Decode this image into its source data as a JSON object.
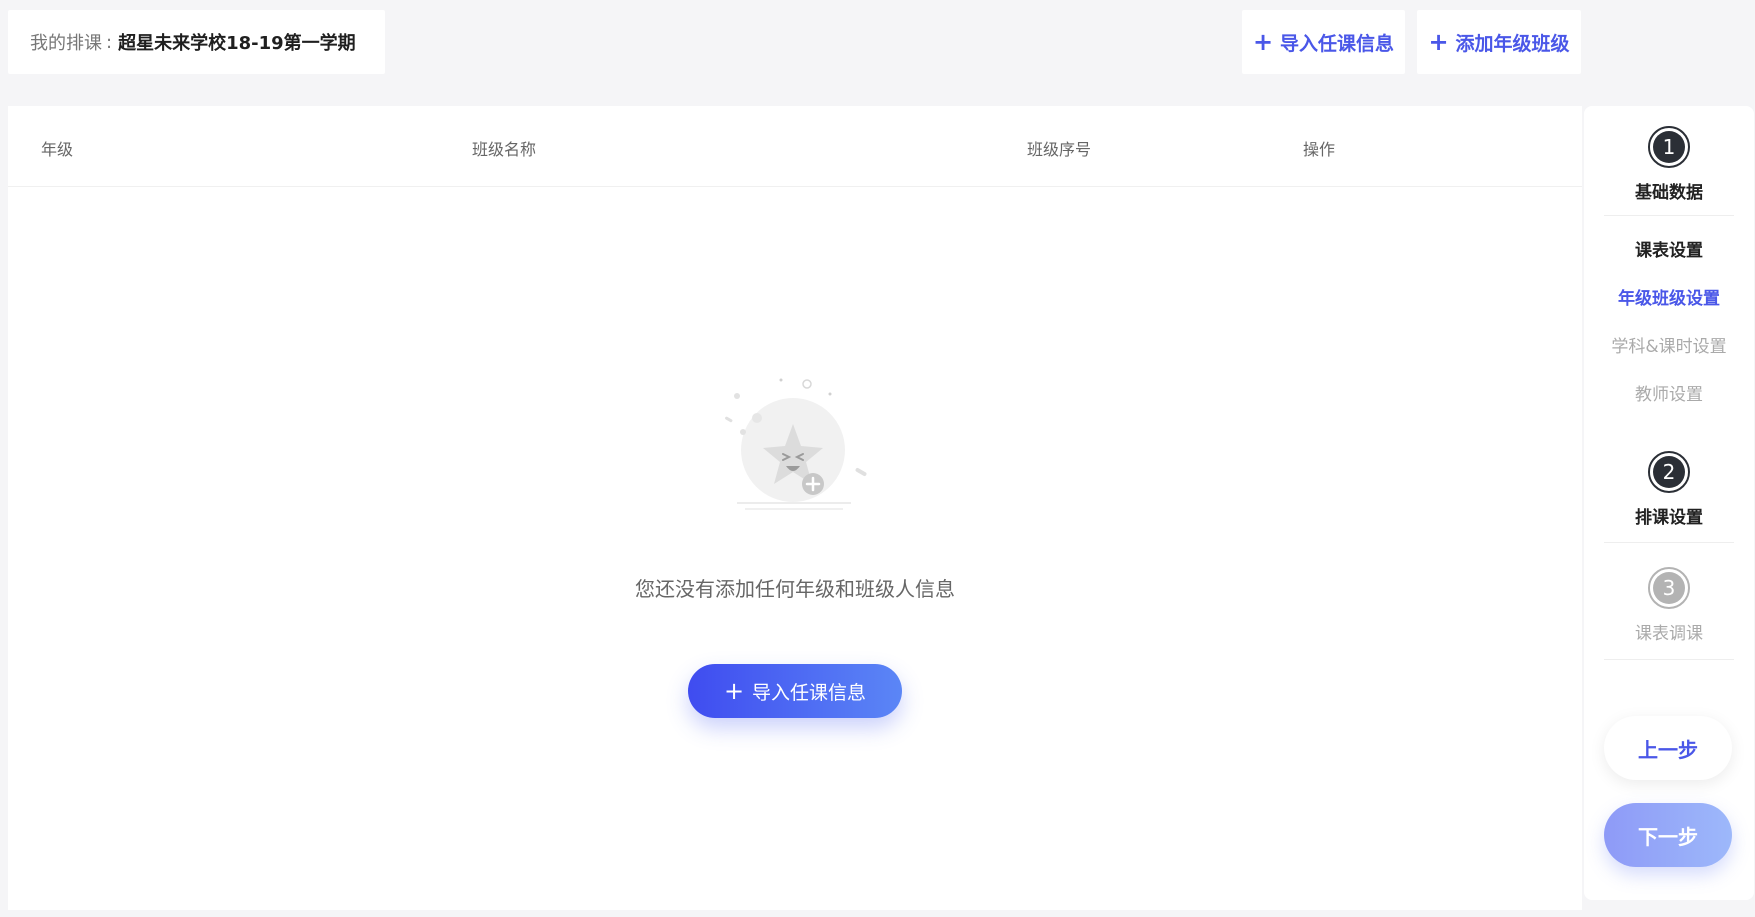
{
  "header": {
    "crumb_label": "我的排课",
    "crumb_sep": ":",
    "crumb_value": "超星未来学校18-19第一学期"
  },
  "toolbar": {
    "plus_glyph": "+",
    "import_label": "导入任课信息",
    "add_grade_label": "添加年级班级"
  },
  "table": {
    "columns": [
      "年级",
      "班级名称",
      "班级序号",
      "操作"
    ]
  },
  "empty": {
    "message": "您还没有添加任何年级和班级人信息",
    "cta_label": "导入任课信息"
  },
  "stepper": {
    "steps": [
      {
        "number": "1",
        "title": "基础数据",
        "state": "current"
      },
      {
        "number": "2",
        "title": "排课设置",
        "state": "current"
      },
      {
        "number": "3",
        "title": "课表调课",
        "state": "disabled"
      }
    ],
    "sub_items": [
      {
        "label": "课表设置",
        "state": "done"
      },
      {
        "label": "年级班级设置",
        "state": "active"
      },
      {
        "label": "学科&课时设置",
        "state": "todo"
      },
      {
        "label": "教师设置",
        "state": "todo"
      }
    ],
    "prev_label": "上一步",
    "next_label": "下一步"
  },
  "colors": {
    "accent": "#4a57e8",
    "background": "#f5f5f7",
    "step_dark": "#2b2f36",
    "step_disabled": "#b3b3b3"
  }
}
